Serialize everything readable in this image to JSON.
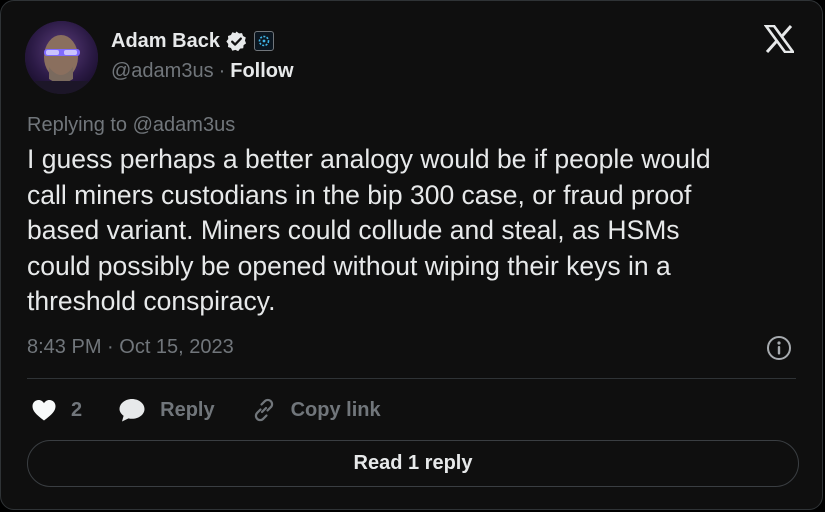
{
  "author": {
    "name": "Adam Back",
    "handle": "@adam3us",
    "separator": "·",
    "follow_label": "Follow"
  },
  "icons": {
    "verified": "verified-badge-icon",
    "affiliate": "affiliate-badge-icon",
    "brand": "x-logo-icon",
    "info": "info-icon",
    "like": "heart-icon",
    "reply": "speech-bubble-icon",
    "copy": "link-icon"
  },
  "tweet": {
    "replying_to": "Replying to @adam3us",
    "text": "I guess perhaps a better analogy would be if people would\ncall miners custodians in the bip 300 case, or fraud proof\nbased variant. Miners could collude and steal, as HSMs\ncould possibly be opened without wiping their keys in a\nthreshold conspiracy.",
    "timestamp": "8:43 PM · Oct 15, 2023"
  },
  "actions": {
    "like_count": "2",
    "reply_label": "Reply",
    "copy_label": "Copy link"
  },
  "read_replies_label": "Read 1 reply",
  "colors": {
    "background": "#0f0f0f",
    "text_primary": "#e7e9ea",
    "text_secondary": "#71767b",
    "border": "#2f3336",
    "like_heart": "#f7f9f9"
  }
}
